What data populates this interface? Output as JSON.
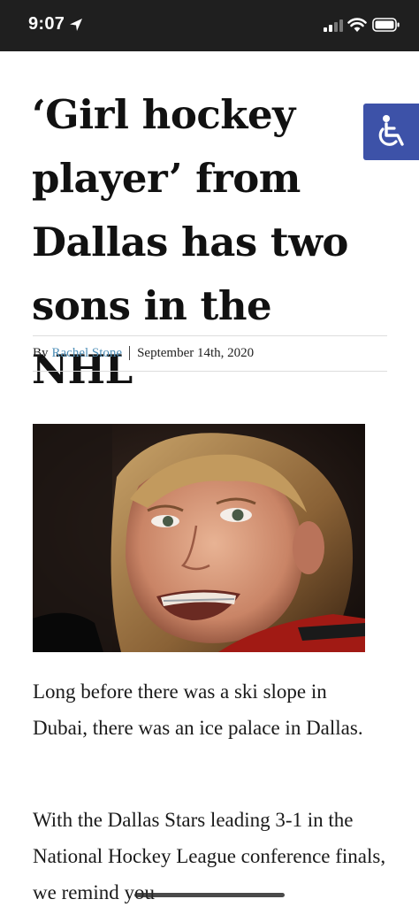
{
  "status_bar": {
    "time": "9:07"
  },
  "article": {
    "title": "‘Girl hockey player’ from Dallas has two sons in the NHL",
    "byline_prefix": "By",
    "author": "Rachel Stone",
    "date": "September 14th, 2020",
    "paragraphs": [
      "Long before there was a ski slope in Dubai, there was an ice palace in Dallas.",
      "With the Dallas Stars leading 3-1 in the National Hockey League conference finals, we remind you"
    ]
  },
  "colors": {
    "accessibility_button": "#3d52a8",
    "author_link": "#4f8fb8",
    "status_bar": "#1f1f1f"
  },
  "icons": [
    "location-arrow-icon",
    "cellular-signal-icon",
    "wifi-icon",
    "battery-icon",
    "accessibility-icon"
  ]
}
